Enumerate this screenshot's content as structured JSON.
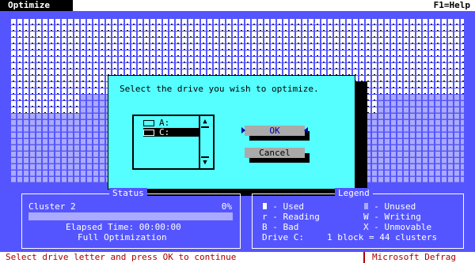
{
  "menubar": {
    "menu": "Optimize",
    "help": "F1=Help"
  },
  "dialog": {
    "prompt": "Select the drive you wish to optimize.",
    "drives": [
      {
        "label": "A:",
        "selected": false
      },
      {
        "label": "C:",
        "selected": true
      }
    ],
    "ok_label": "OK",
    "cancel_label": "Cancel"
  },
  "status": {
    "title": "Status",
    "cluster_label": "Cluster 2",
    "percent_label": "0%",
    "progress_fraction": 0.0,
    "elapsed": "Elapsed Time: 00:00:00",
    "method": "Full Optimization"
  },
  "legend": {
    "title": "Legend",
    "used": "- Used",
    "unused": "- Unused",
    "reading": "r - Reading",
    "writing": "W - Writing",
    "bad": "B - Bad",
    "unmovable": "X - Unmovable",
    "drive": "Drive C:",
    "block": "1 block = 44 clusters"
  },
  "statusbar": {
    "message": "Select drive letter and press OK to continue",
    "app": "Microsoft Defrag"
  },
  "colors": {
    "background": "#5555ff",
    "dialog": "#55ffff",
    "unused_block": "#aaaaff",
    "used_block": "#ffffff",
    "accent_text": "#aa0000"
  }
}
